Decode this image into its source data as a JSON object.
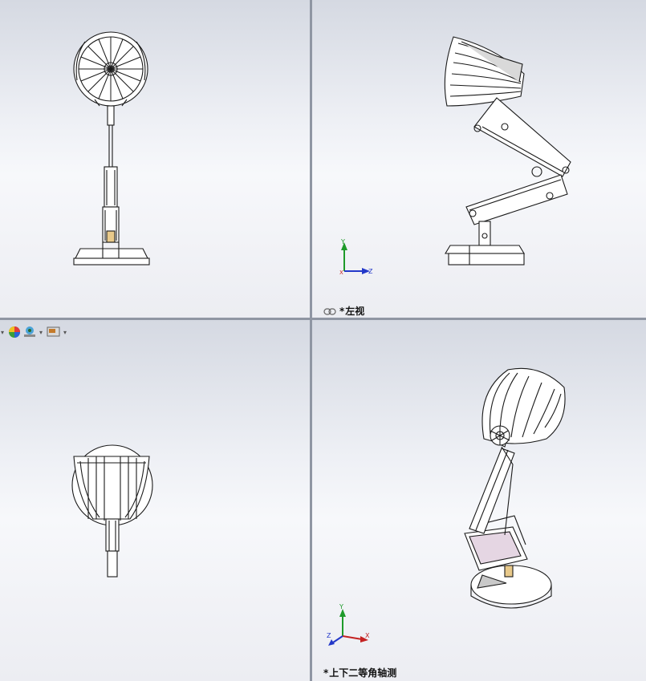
{
  "viewports": [
    {
      "id": "front",
      "label": ""
    },
    {
      "id": "left",
      "label": "左视",
      "prefix": "*"
    },
    {
      "id": "top",
      "label": ""
    },
    {
      "id": "iso",
      "label": "上下二等角轴测",
      "prefix": "*"
    }
  ],
  "triad_axes": {
    "y": "Y",
    "z": "Z",
    "x": "X"
  },
  "toolbar": {
    "icons": [
      "appearance-sphere-icon",
      "scene-icon",
      "display-manager-icon"
    ]
  },
  "colors": {
    "wire": "#1a1a1a",
    "face": "#ffffff",
    "wood": "#e8c98a",
    "accent": "#d9c7d6",
    "axis_y": "#1e9a2a",
    "axis_z": "#2338c9",
    "axis_x": "#c42222"
  }
}
